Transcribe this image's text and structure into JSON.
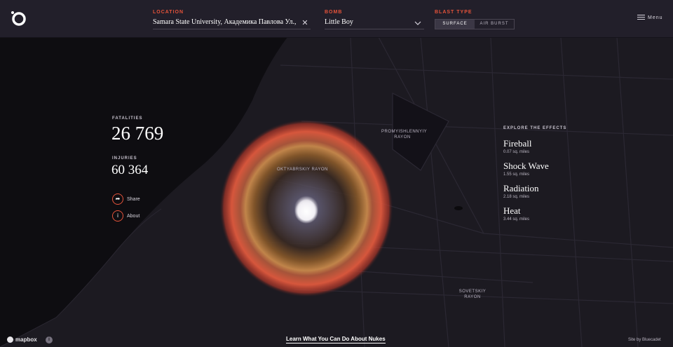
{
  "header": {
    "location_label": "Location",
    "location_value": "Samara State University, Академика Павлова Ул., д",
    "bomb_label": "Bomb",
    "bomb_value": "Little Boy",
    "blast_type_label": "Blast Type",
    "blast_options": [
      "Surface",
      "Air Burst"
    ],
    "blast_selected": "Surface",
    "menu_label": "Menu"
  },
  "stats": {
    "fatalities_label": "Fatalities",
    "fatalities_value": "26 769",
    "injuries_label": "Injuries",
    "injuries_value": "60 364"
  },
  "actions": {
    "share_label": "Share",
    "about_label": "About"
  },
  "effects": {
    "title": "Explore the Effects",
    "items": [
      {
        "name": "Fireball",
        "area": "0.07 sq. miles"
      },
      {
        "name": "Shock Wave",
        "area": "1.55 sq. miles"
      },
      {
        "name": "Radiation",
        "area": "2.18 sq. miles"
      },
      {
        "name": "Heat",
        "area": "3.44 sq. miles"
      }
    ]
  },
  "map_labels": {
    "oktyabrskiy": "Oktyabrskiy Rayon",
    "promyishlennyiy": "Promyishlennyiy Rayon",
    "sovetskiy": "Sovetskiy Rayon"
  },
  "footer": {
    "cta": "Learn What You Can Do About Nukes",
    "mapbox": "mapbox",
    "credit": "Site by Bluecadet"
  },
  "icons": {
    "logo": "ring-logo-icon",
    "clear": "close-icon",
    "dropdown": "chevron-down-icon",
    "menu": "hamburger-icon",
    "share": "share-arrow-icon",
    "about": "info-icon"
  },
  "colors": {
    "accent": "#e5533a",
    "background": "#1b1820",
    "header": "#221f2a"
  }
}
